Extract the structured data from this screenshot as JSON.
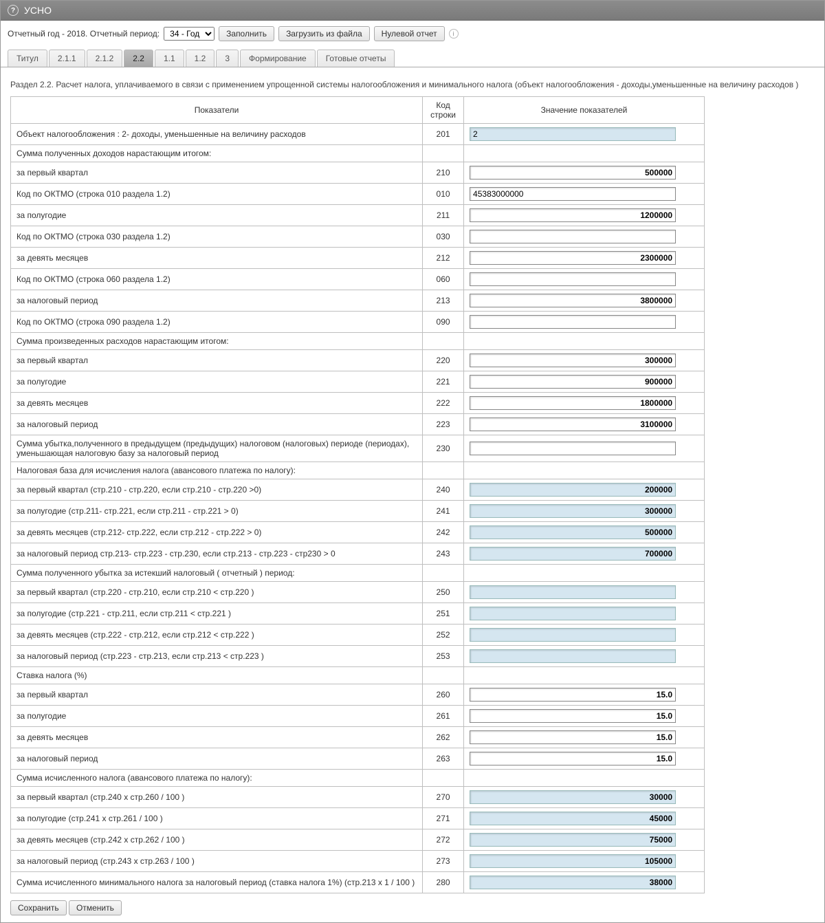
{
  "header": {
    "title": "УСНО"
  },
  "toolbar": {
    "year_label": "Отчетный год - 2018.  Отчетный период:",
    "period_selected": "34 - Год",
    "fill_btn": "Заполнить",
    "load_btn": "Загрузить из файла",
    "zero_btn": "Нулевой отчет"
  },
  "tabs": [
    "Титул",
    "2.1.1",
    "2.1.2",
    "2.2",
    "1.1",
    "1.2",
    "3",
    "Формирование",
    "Готовые отчеты"
  ],
  "active_tab": "2.2",
  "section_title": "Раздел 2.2. Расчет налога, уплачиваемого в связи с применением упрощенной системы налогообложения и минимального налога (объект налогообложения - доходы,уменьшенные на величину расходов )",
  "columns": {
    "c1": "Показатели",
    "c2": "Код строки",
    "c3": "Значение показателей"
  },
  "rows": [
    {
      "label": "Объект налогообложения : 2- доходы, уменьшенные на величину расходов",
      "code": "201",
      "value": "2",
      "readonly": true,
      "align": "left"
    },
    {
      "label": "Сумма полученных доходов нарастающим итогом:",
      "header": true
    },
    {
      "label": "за первый квартал",
      "code": "210",
      "value": "500000",
      "align": "right"
    },
    {
      "label": "Код по ОКТМО (строка 010 раздела 1.2)",
      "code": "010",
      "value": "45383000000",
      "align": "left"
    },
    {
      "label": "за полугодие",
      "code": "211",
      "value": "1200000",
      "align": "right"
    },
    {
      "label": "Код по ОКТМО (строка 030 раздела 1.2)",
      "code": "030",
      "value": "",
      "align": "left"
    },
    {
      "label": "за девять месяцев",
      "code": "212",
      "value": "2300000",
      "align": "right"
    },
    {
      "label": "Код по ОКТМО (строка 060 раздела 1.2)",
      "code": "060",
      "value": "",
      "align": "left"
    },
    {
      "label": "за налоговый период",
      "code": "213",
      "value": "3800000",
      "align": "right"
    },
    {
      "label": "Код по ОКТМО (строка 090 раздела 1.2)",
      "code": "090",
      "value": "",
      "align": "left"
    },
    {
      "label": "Сумма произведенных расходов нарастающим итогом:",
      "header": true
    },
    {
      "label": "за первый квартал",
      "code": "220",
      "value": "300000",
      "align": "right"
    },
    {
      "label": "за полугодие",
      "code": "221",
      "value": "900000",
      "align": "right"
    },
    {
      "label": "за девять месяцев",
      "code": "222",
      "value": "1800000",
      "align": "right"
    },
    {
      "label": "за налоговый период",
      "code": "223",
      "value": "3100000",
      "align": "right"
    },
    {
      "label": "Сумма убытка,полученного в предыдущем (предыдущих) налоговом (налоговых) периоде (периодах), уменьшающая налоговую базу за налоговый период",
      "code": "230",
      "value": "",
      "align": "left"
    },
    {
      "label": "Налоговая база для исчисления налога (авансового платежа по налогу):",
      "header": true
    },
    {
      "label": "за первый квартал (стр.210 - стр.220, если стр.210 - стр.220 >0)",
      "code": "240",
      "value": "200000",
      "readonly": true,
      "align": "right"
    },
    {
      "label": "за полугодие (стр.211- стр.221, если стр.211 - стр.221 > 0)",
      "code": "241",
      "value": "300000",
      "readonly": true,
      "align": "right"
    },
    {
      "label": "за девять месяцев (стр.212- стр.222, если стр.212 - стр.222 > 0)",
      "code": "242",
      "value": "500000",
      "readonly": true,
      "align": "right"
    },
    {
      "label": "за налоговый период стр.213- стр.223 - стр.230, если стр.213 - стр.223 - стр230 > 0",
      "code": "243",
      "value": "700000",
      "readonly": true,
      "align": "right"
    },
    {
      "label": "Сумма полученного убытка за истекший налоговый ( отчетный ) период:",
      "header": true
    },
    {
      "label": "за первый квартал (стр.220 - стр.210, если стр.210 < стр.220 )",
      "code": "250",
      "value": "",
      "readonly": true,
      "align": "right"
    },
    {
      "label": "за полугодие (стр.221 - стр.211, если стр.211 < стр.221 )",
      "code": "251",
      "value": "",
      "readonly": true,
      "align": "right"
    },
    {
      "label": "за девять месяцев (стр.222 - стр.212, если стр.212 < стр.222 )",
      "code": "252",
      "value": "",
      "readonly": true,
      "align": "right"
    },
    {
      "label": "за налоговый период (стр.223 - стр.213, если стр.213 < стр.223 )",
      "code": "253",
      "value": "",
      "readonly": true,
      "align": "right"
    },
    {
      "label": "Ставка налога (%)",
      "header": true
    },
    {
      "label": "за первый квартал",
      "code": "260",
      "value": "15.0",
      "align": "right"
    },
    {
      "label": "за полугодие",
      "code": "261",
      "value": "15.0",
      "align": "right"
    },
    {
      "label": "за девять месяцев",
      "code": "262",
      "value": "15.0",
      "align": "right"
    },
    {
      "label": "за налоговый период",
      "code": "263",
      "value": "15.0",
      "align": "right"
    },
    {
      "label": "Сумма исчисленного налога (авансового платежа по налогу):",
      "header": true
    },
    {
      "label": "за первый квартал (стр.240 x стр.260 / 100 )",
      "code": "270",
      "value": "30000",
      "readonly": true,
      "align": "right"
    },
    {
      "label": "за полугодие (стр.241 x стр.261 / 100 )",
      "code": "271",
      "value": "45000",
      "readonly": true,
      "align": "right"
    },
    {
      "label": "за девять месяцев (стр.242 x стр.262 / 100 )",
      "code": "272",
      "value": "75000",
      "readonly": true,
      "align": "right"
    },
    {
      "label": "за налоговый период (стр.243 x стр.263 / 100 )",
      "code": "273",
      "value": "105000",
      "readonly": true,
      "align": "right"
    },
    {
      "label": "Сумма исчисленного минимального налога за налоговый период (ставка налога 1%) (стр.213 х 1 / 100 )",
      "code": "280",
      "value": "38000",
      "readonly": true,
      "align": "right"
    }
  ],
  "footer": {
    "save": "Сохранить",
    "cancel": "Отменить"
  }
}
